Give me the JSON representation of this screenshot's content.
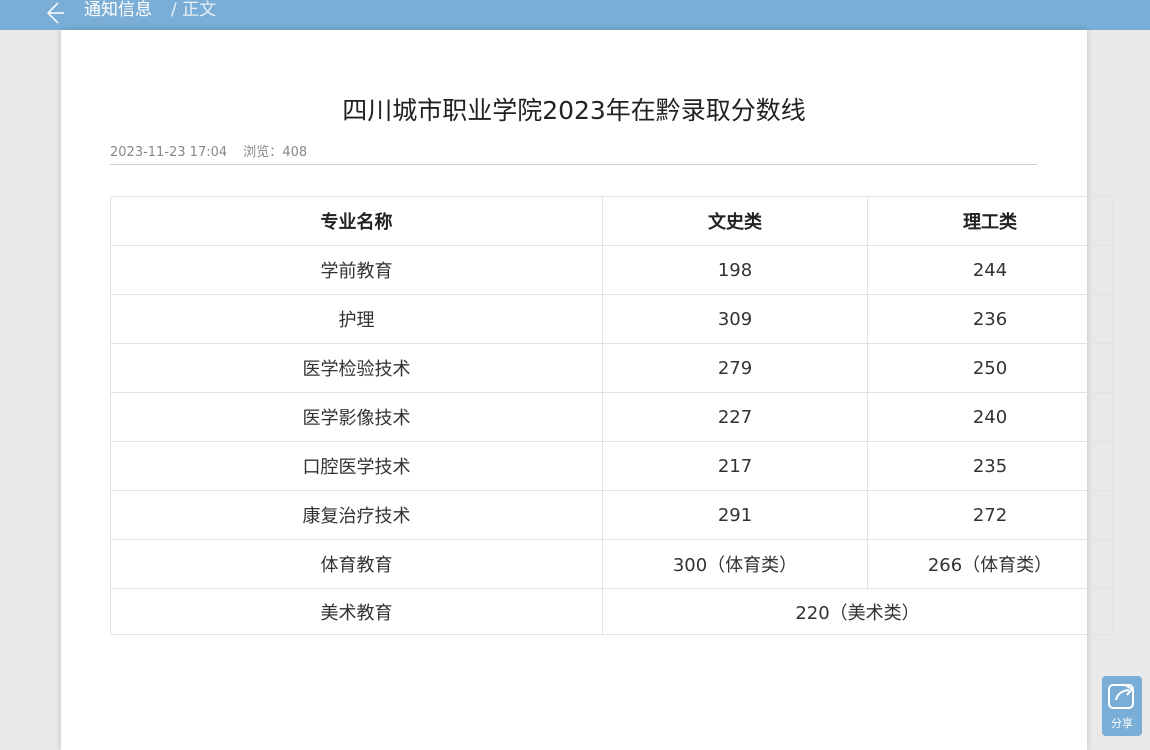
{
  "header": {
    "breadcrumb_current": "通知信息",
    "breadcrumb_sep": "/ 正文",
    "back_icon": "back-arrow-icon"
  },
  "article": {
    "title": "四川城市职业学院2023年在黔录取分数线",
    "date": "2023-11-23 17:04",
    "views_label": "浏览：",
    "views": "408"
  },
  "table": {
    "headers": [
      "专业名称",
      "文史类",
      "理工类"
    ],
    "rows": [
      [
        "学前教育",
        "198",
        "244"
      ],
      [
        "护理",
        "309",
        "236"
      ],
      [
        "医学检验技术",
        "279",
        "250"
      ],
      [
        "医学影像技术",
        "227",
        "240"
      ],
      [
        "口腔医学技术",
        "217",
        "235"
      ],
      [
        "康复治疗技术",
        "291",
        "272"
      ],
      [
        "体育教育",
        "300（体育类）",
        "266（体育类）"
      ]
    ],
    "merged_row": [
      "美术教育",
      "220（美术类）"
    ]
  },
  "share": {
    "label": "分享",
    "icon": "share-icon"
  },
  "colors": {
    "topbar": "#7aaed6",
    "page_bg": "#e9e9e9"
  }
}
